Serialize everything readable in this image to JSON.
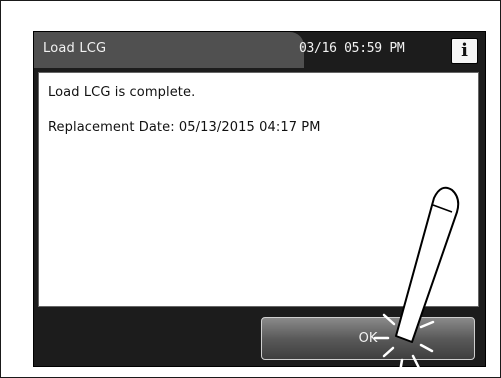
{
  "header": {
    "title": "Load LCG",
    "datetime": "03/16 05:59 PM",
    "info_glyph": "i"
  },
  "message": {
    "line1": "Load LCG is complete.",
    "line2": "Replacement Date: 05/13/2015 04:17 PM"
  },
  "buttons": {
    "ok_label": "OK"
  },
  "icons": {
    "info": "info-icon",
    "touch": "stylus-tap-icon"
  }
}
